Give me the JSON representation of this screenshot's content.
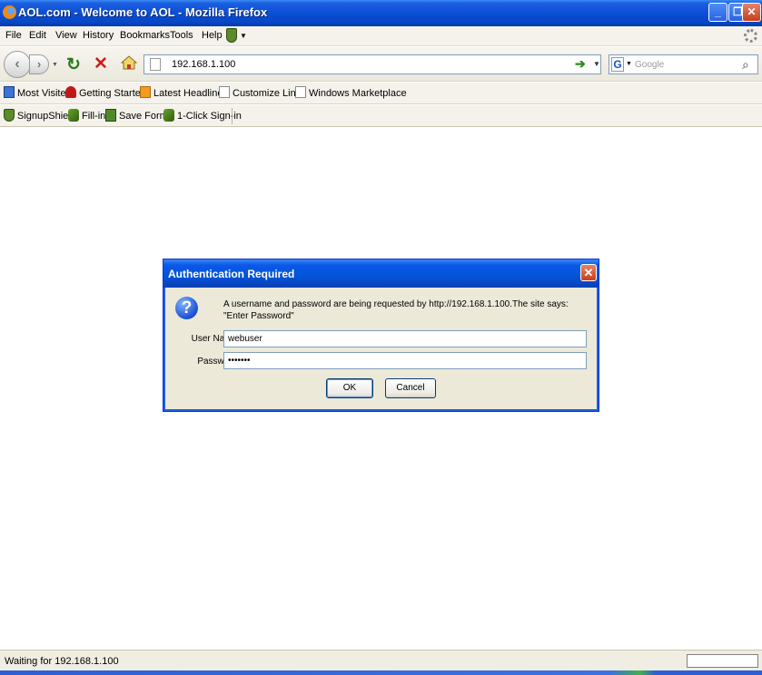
{
  "window": {
    "title": "AOL.com - Welcome to AOL - Mozilla Firefox",
    "minimize": "_",
    "restore": "❐",
    "close": "✕"
  },
  "menu": [
    "File",
    "Edit",
    "View",
    "History",
    "Bookmarks",
    "Tools",
    "Help"
  ],
  "nav": {
    "url": "192.168.1.100",
    "search_placeholder": "Google",
    "search_engine_letter": "G"
  },
  "bookmarks": [
    "Most Visited",
    "Getting Started",
    "Latest Headlines",
    "Customize Links",
    "Windows Marketplace"
  ],
  "toolbar": [
    "SignupShield",
    "Fill-in",
    "Save Form",
    "1-Click Sign-in"
  ],
  "dialog": {
    "title": "Authentication Required",
    "message": "A username and password are being requested by http://192.168.1.100.The site says: \"Enter Password\"",
    "username_label": "User Name:",
    "username_value": "webuser",
    "password_label": "Password:",
    "password_value": "•••••••",
    "ok_label": "OK",
    "cancel_label": "Cancel"
  },
  "status": {
    "text": "Waiting for 192.168.1.100"
  },
  "colors": {
    "titlebar": "#0a4fd6",
    "dialog_bg": "#ece9d8",
    "chrome_bg": "#f4f2ea"
  }
}
